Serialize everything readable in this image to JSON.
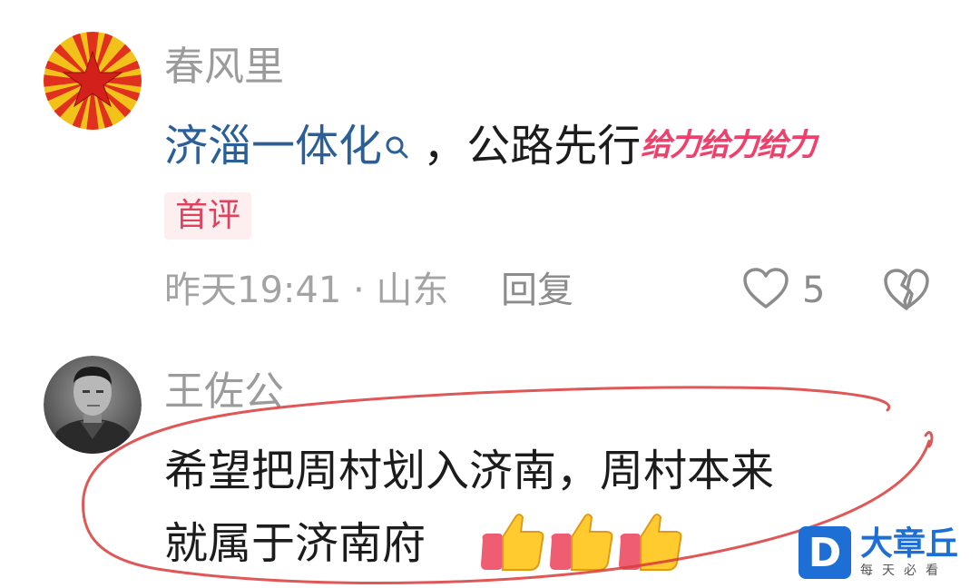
{
  "comments": [
    {
      "username": "春风里",
      "topic": "济淄一体化",
      "text": "，公路先行",
      "emoji_text": "给力给力给力",
      "badge": "首评",
      "meta": "昨天19:41 · 山东",
      "reply_label": "回复",
      "likes": "5"
    },
    {
      "username": "王佐公",
      "line1": "希望把周村划入济南，周村本来",
      "line2": "就属于济南府"
    }
  ],
  "watermark": {
    "logo_letter": "D",
    "title": "大章丘",
    "subtitle": "每天必看"
  },
  "colors": {
    "topic_link": "#2b5f98",
    "badge_text": "#e0425e",
    "annotation": "#d93a3a",
    "watermark": "#1d6fd6"
  }
}
